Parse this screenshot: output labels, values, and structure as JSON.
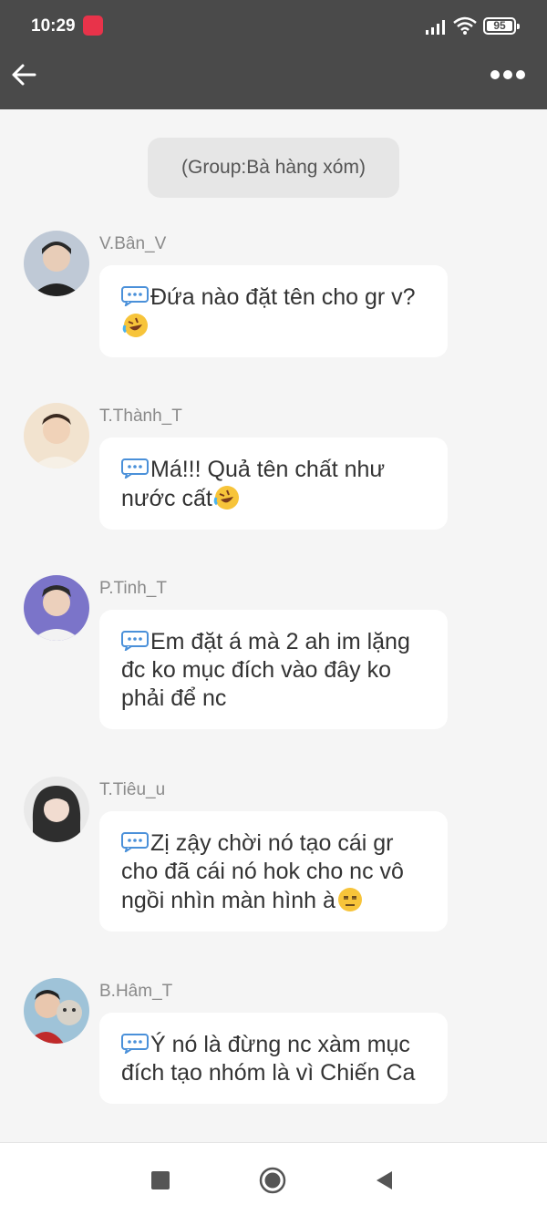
{
  "status_bar": {
    "time": "10:29",
    "app_badge": "MANGA TOON",
    "battery": "95"
  },
  "header": {
    "back_icon": "arrow-left-icon",
    "menu_icon": "more-horizontal-icon"
  },
  "group_notice": "(Group:Bà hàng xóm)",
  "messages": [
    {
      "sender": "V.Bân_V",
      "text": "Đứa nào đặt tên cho gr v?",
      "emoji": "rolling-on-floor-laughing"
    },
    {
      "sender": "T.Thành_T",
      "text": "Má!!! Quả tên chất như nước cất",
      "emoji": "rolling-on-floor-laughing"
    },
    {
      "sender": "P.Tinh_T",
      "text": "Em đặt á mà 2 ah im lặng đc ko mục đích vào đây ko phải để nc",
      "emoji": ""
    },
    {
      "sender": "T.Tiêu_u",
      "text": "Zị zậy chời nó tạo cái gr cho đã cái nó hok cho nc vô ngồi nhìn màn hình à",
      "emoji": "expressionless-face"
    },
    {
      "sender": "B.Hâm_T",
      "text": "Ý nó là đừng nc xàm mục đích tạo nhóm là vì Chiến Ca",
      "emoji": ""
    }
  ],
  "colors": {
    "header_bg": "#4a4a4a",
    "chat_bg": "#f5f5f5",
    "bubble_bg": "#ffffff",
    "pill_bg": "#e6e6e6"
  }
}
